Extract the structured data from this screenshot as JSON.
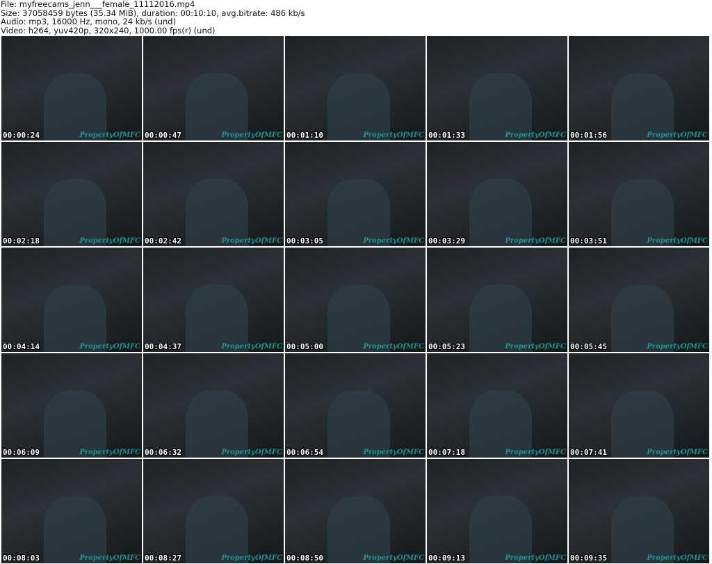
{
  "header": {
    "file": "File: myfreecams_jenn___female_11112016.mp4",
    "size": "Size: 37058459 bytes (35.34 MiB), duration: 00:10:10, avg.bitrate: 486 kb/s",
    "audio": "Audio: mp3, 16000 Hz, mono, 24 kb/s (und)",
    "video": "Video: h264, yuv420p, 320x240, 1000.00 fps(r) (und)"
  },
  "watermark": "PropertyOfMFC",
  "thumbnails": [
    "00:00:24",
    "00:00:47",
    "00:01:10",
    "00:01:33",
    "00:01:56",
    "00:02:18",
    "00:02:42",
    "00:03:05",
    "00:03:29",
    "00:03:51",
    "00:04:14",
    "00:04:37",
    "00:05:00",
    "00:05:23",
    "00:05:45",
    "00:06:09",
    "00:06:32",
    "00:06:54",
    "00:07:18",
    "00:07:41",
    "00:08:03",
    "00:08:27",
    "00:08:50",
    "00:09:13",
    "00:09:35"
  ]
}
